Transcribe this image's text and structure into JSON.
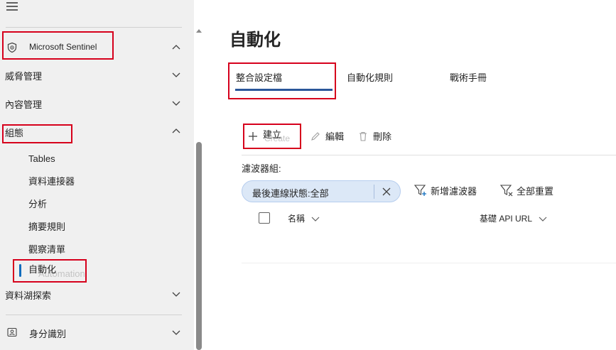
{
  "sidebar": {
    "sentinel_label": "Microsoft Sentinel",
    "threat_management": "威脅管理",
    "content_management": "內容管理",
    "configuration": "組態",
    "sub_items": [
      "Tables",
      "資料連接器",
      "分析",
      "摘要規則",
      "觀察清單",
      "自動化"
    ],
    "automation_ghost": "Automation",
    "data_lake": "資料湖探索",
    "identity": "身分識別"
  },
  "main": {
    "title": "自動化",
    "tabs": [
      "整合設定檔",
      "自動化規則",
      "戰術手冊"
    ],
    "commands": {
      "create": "建立",
      "create_ghost": "Create",
      "edit": "編輯",
      "delete": "刪除"
    },
    "filters": {
      "label": "濾波器組:",
      "pill_text": "最後連線狀態:全部",
      "add_filter": "新增濾波器",
      "reset_all": "全部重置"
    },
    "table": {
      "columns": [
        "名稱",
        "基礎 API URL"
      ]
    }
  },
  "colors": {
    "highlight": "#d6001c",
    "accent": "#2b579a",
    "pill_bg": "#dce8f7"
  }
}
